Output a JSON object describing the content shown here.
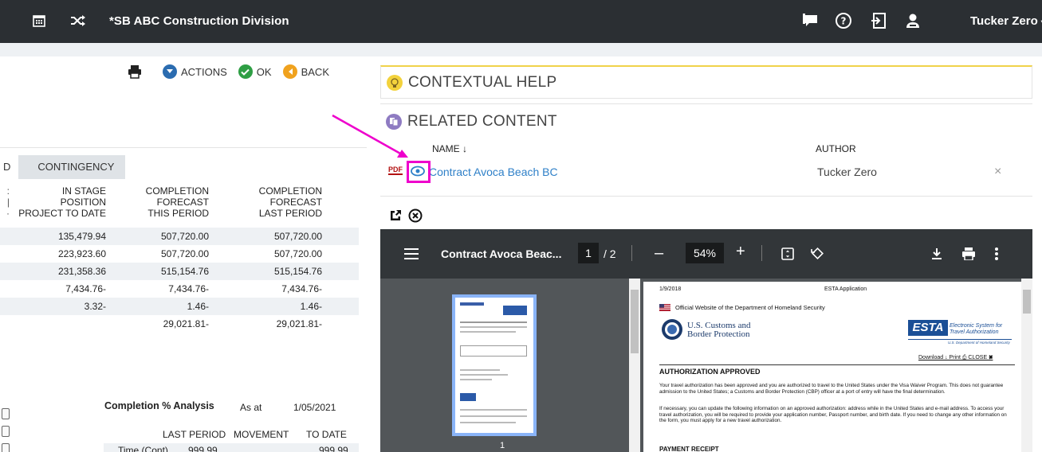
{
  "topbar": {
    "title": "*SB ABC Construction Division",
    "user": "Tucker Zero",
    "icons": [
      "calendar-icon",
      "shuffle-icon",
      "chat-icon",
      "help-icon",
      "logout-icon",
      "user-icon",
      "caret-down-icon"
    ]
  },
  "toolbar": {
    "actions": "ACTIONS",
    "ok": "OK",
    "back": "BACK"
  },
  "tabs": [
    "D",
    "CONTINGENCY"
  ],
  "grid": {
    "headers": [
      {
        "lines": [
          "IN STAGE",
          "POSITION",
          "PROJECT TO DATE"
        ]
      },
      {
        "lines": [
          "COMPLETION",
          "FORECAST",
          "THIS PERIOD"
        ]
      },
      {
        "lines": [
          "COMPLETION",
          "FORECAST",
          "LAST PERIOD"
        ]
      }
    ],
    "rows": [
      [
        "135,479.94",
        "507,720.00",
        "507,720.00"
      ],
      [
        "223,923.60",
        "507,720.00",
        "507,720.00"
      ],
      [
        "231,358.36",
        "515,154.76",
        "515,154.76"
      ],
      [
        "7,434.76-",
        "7,434.76-",
        "7,434.76-"
      ],
      [
        "3.32-",
        "1.46-",
        "1.46-"
      ],
      [
        "",
        "29,021.81-",
        "29,021.81-"
      ]
    ]
  },
  "analysis": {
    "title": "Completion % Analysis",
    "as_at_label": "As at",
    "as_at_value": "1/05/2021",
    "col_last": "LAST PERIOD",
    "col_move": "MOVEMENT",
    "col_todate": "TO DATE",
    "row_label": "Time (Cont)",
    "row_last": "999.99",
    "row_todate": "999.99"
  },
  "help": {
    "title": "CONTEXTUAL HELP"
  },
  "related": {
    "title": "RELATED CONTENT",
    "col_name": "NAME",
    "col_author": "AUTHOR",
    "file_type": "PDF",
    "item_name": "Contract Avoca Beach BC",
    "item_author": "Tucker Zero",
    "remove_glyph": "×"
  },
  "viewer": {
    "doc_title": "Contract Avoca Beac...",
    "page_current": "1",
    "page_total": "/ 2",
    "zoom": "54%",
    "thumb_number": "1"
  },
  "page": {
    "date": "1/9/2018",
    "app": "ESTA Application",
    "official": "Official Website of the Department of Homeland Security",
    "agency_line1": "U.S. Customs and",
    "agency_line2": "Border Protection",
    "esta": "ESTA",
    "esta_sub1": "Electronic System for",
    "esta_sub2": "Travel Authorization",
    "esta_sub3": "U.S. Department of Homeland Security",
    "links": "Download ↓  Print ⎙  CLOSE ✖",
    "heading": "AUTHORIZATION APPROVED",
    "p1": "Your travel authorization has been approved and you are authorized to travel to the United States under the Visa Waiver Program. This does not guarantee admission to the United States; a Customs and Border Protection (CBP) officer at a port of entry will have the final determination.",
    "p2": "If necessary, you can update the following information on an approved authorization: address while in the United States and e-mail address. To access your travel authorization, you will be required to provide your application number, Passport number, and birth date. If you need to change any other information on the form, you must apply for a new travel authorization.",
    "receipt": "PAYMENT RECEIPT"
  },
  "colors": {
    "topbar": "#2b2f33",
    "accent_blue": "#2b6cb0",
    "ok_green": "#2e9e44",
    "back_orange": "#f0a21e",
    "highlight": "#ee00cc",
    "link": "#2f80c8"
  }
}
